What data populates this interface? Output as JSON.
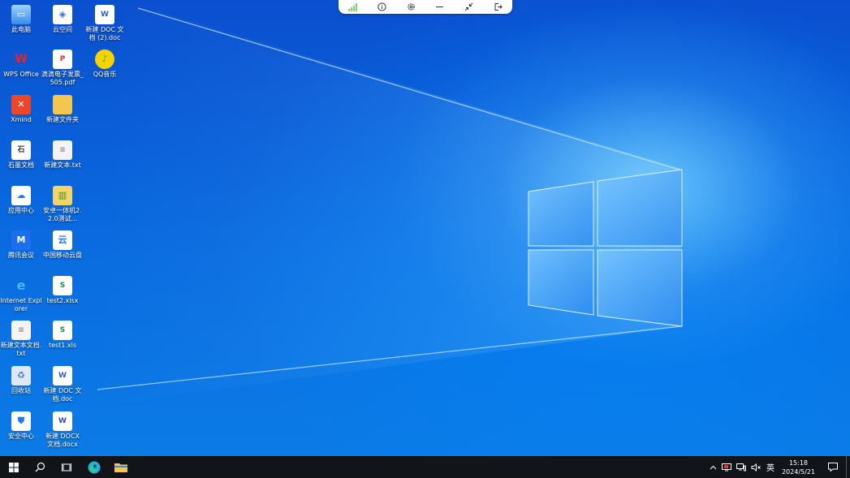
{
  "remote_toolbar": {
    "buttons": [
      "signal-icon",
      "info-icon",
      "gear-icon",
      "minimize-icon",
      "collapse-icon",
      "exit-icon"
    ]
  },
  "desktop": {
    "icons": [
      {
        "label": "此电脑",
        "icon": "computer-icon"
      },
      {
        "label": "云空间",
        "icon": "cloud-space-icon"
      },
      {
        "label": "新建 DOC 文档 (2).doc",
        "icon": "word-doc-icon"
      },
      {
        "label": "WPS Office",
        "icon": "wps-icon"
      },
      {
        "label": "滴滴电子发票_505.pdf",
        "icon": "pdf-icon"
      },
      {
        "label": "QQ音乐",
        "icon": "qq-music-icon"
      },
      {
        "label": "Xmind",
        "icon": "xmind-icon"
      },
      {
        "label": "新建文件夹",
        "icon": "folder-icon"
      },
      {
        "label": "石墨文档",
        "icon": "shimo-icon"
      },
      {
        "label": "新建文本.txt",
        "icon": "txt-icon"
      },
      {
        "label": "应用中心",
        "icon": "app-center-icon"
      },
      {
        "label": "安卓一体机2.2.0测试...",
        "icon": "archive-icon"
      },
      {
        "label": "腾讯会议",
        "icon": "tencent-meeting-icon"
      },
      {
        "label": "中国移动云盘",
        "icon": "mobile-cloud-icon"
      },
      {
        "label": "Internet Explorer",
        "icon": "ie-icon"
      },
      {
        "label": "test2.xlsx",
        "icon": "excel-icon"
      },
      {
        "label": "新建文本文档.txt",
        "icon": "txt-icon"
      },
      {
        "label": "test1.xls",
        "icon": "excel-icon"
      },
      {
        "label": "回收站",
        "icon": "recycle-bin-icon"
      },
      {
        "label": "新建 DOC 文档.doc",
        "icon": "word-doc-icon"
      },
      {
        "label": "安全中心",
        "icon": "security-icon"
      },
      {
        "label": "新建 DOCX 文档.docx",
        "icon": "word-docx-icon"
      }
    ]
  },
  "taskbar": {
    "tray": {
      "ime": "英",
      "time": "15:18",
      "date": "2024/5/21"
    }
  },
  "colors": {
    "taskbar": "#111418",
    "wallpaper_accent": "#0a63d8"
  }
}
